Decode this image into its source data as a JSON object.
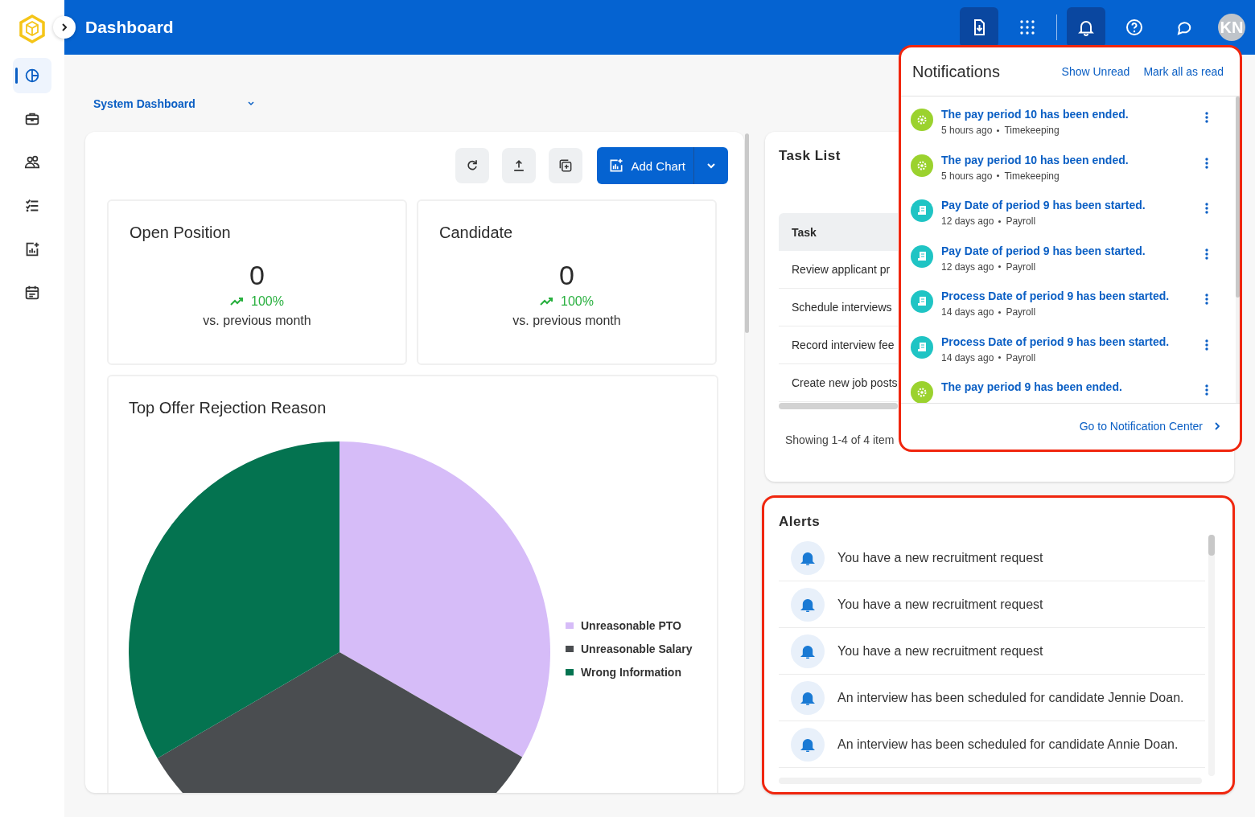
{
  "sidebar": {
    "items": [
      {
        "selected": true
      },
      {
        "selected": false
      },
      {
        "selected": false
      },
      {
        "selected": false
      },
      {
        "selected": false
      },
      {
        "selected": false
      }
    ]
  },
  "header": {
    "title": "Dashboard",
    "tools": [
      {
        "active": true
      },
      {
        "active": false
      },
      {
        "active": true
      },
      {
        "active": false
      },
      {
        "active": false
      }
    ],
    "avatar": "KN"
  },
  "dashboard_selector": {
    "value": "System Dashboard"
  },
  "toolbar": {
    "add_chart": "Add Chart"
  },
  "stats": [
    {
      "title": "Open Position",
      "value": "0",
      "change": "100%",
      "caption": "vs. previous month"
    },
    {
      "title": "Candidate",
      "value": "0",
      "change": "100%",
      "caption": "vs. previous month"
    }
  ],
  "chart_card": {
    "title": "Top Offer Rejection Reason",
    "legend": [
      {
        "color": "#d6bcf8"
      },
      {
        "color": "#4a4d50"
      },
      {
        "color": "#047350"
      }
    ],
    "chart_data": {
      "type": "pie",
      "categories": [
        "Unreasonable PTO",
        "Unreasonable Salary",
        "Wrong Information"
      ],
      "values": [
        33.3,
        33.3,
        33.4
      ],
      "legend": "right"
    }
  },
  "task_list": {
    "title": "Task List",
    "column": "Task",
    "rows": [
      "Review applicant pr",
      "Schedule interviews",
      "Record interview fee",
      "Create new job posts"
    ],
    "footer": "Showing 1-4 of 4 item"
  },
  "notifications": {
    "title": "Notifications",
    "actions": [
      "Show Unread",
      "Mark all as read"
    ],
    "items": [
      {
        "kind": "timekeeping",
        "title": "The pay period 10 has been ended.",
        "time": "5 hours ago",
        "source": "Timekeeping"
      },
      {
        "kind": "timekeeping",
        "title": "The pay period 10 has been ended.",
        "time": "5 hours ago",
        "source": "Timekeeping"
      },
      {
        "kind": "payroll",
        "title": "Pay Date of period 9 has been started.",
        "time": "12 days ago",
        "source": "Payroll"
      },
      {
        "kind": "payroll",
        "title": "Pay Date of period 9 has been started.",
        "time": "12 days ago",
        "source": "Payroll"
      },
      {
        "kind": "payroll",
        "title": "Process Date of period 9 has been started.",
        "time": "14 days ago",
        "source": "Payroll"
      },
      {
        "kind": "payroll",
        "title": "Process Date of period 9 has been started.",
        "time": "14 days ago",
        "source": "Payroll"
      },
      {
        "kind": "timekeeping",
        "title": "The pay period 9 has been ended."
      }
    ],
    "footer_link": "Go to Notification Center"
  },
  "alerts": {
    "title": "Alerts",
    "items": [
      "You have a new recruitment request",
      "You have a new recruitment request",
      "You have a new recruitment request",
      "An interview has been scheduled for candidate Jennie Doan.",
      "An interview has been scheduled for candidate Annie Doan."
    ]
  }
}
